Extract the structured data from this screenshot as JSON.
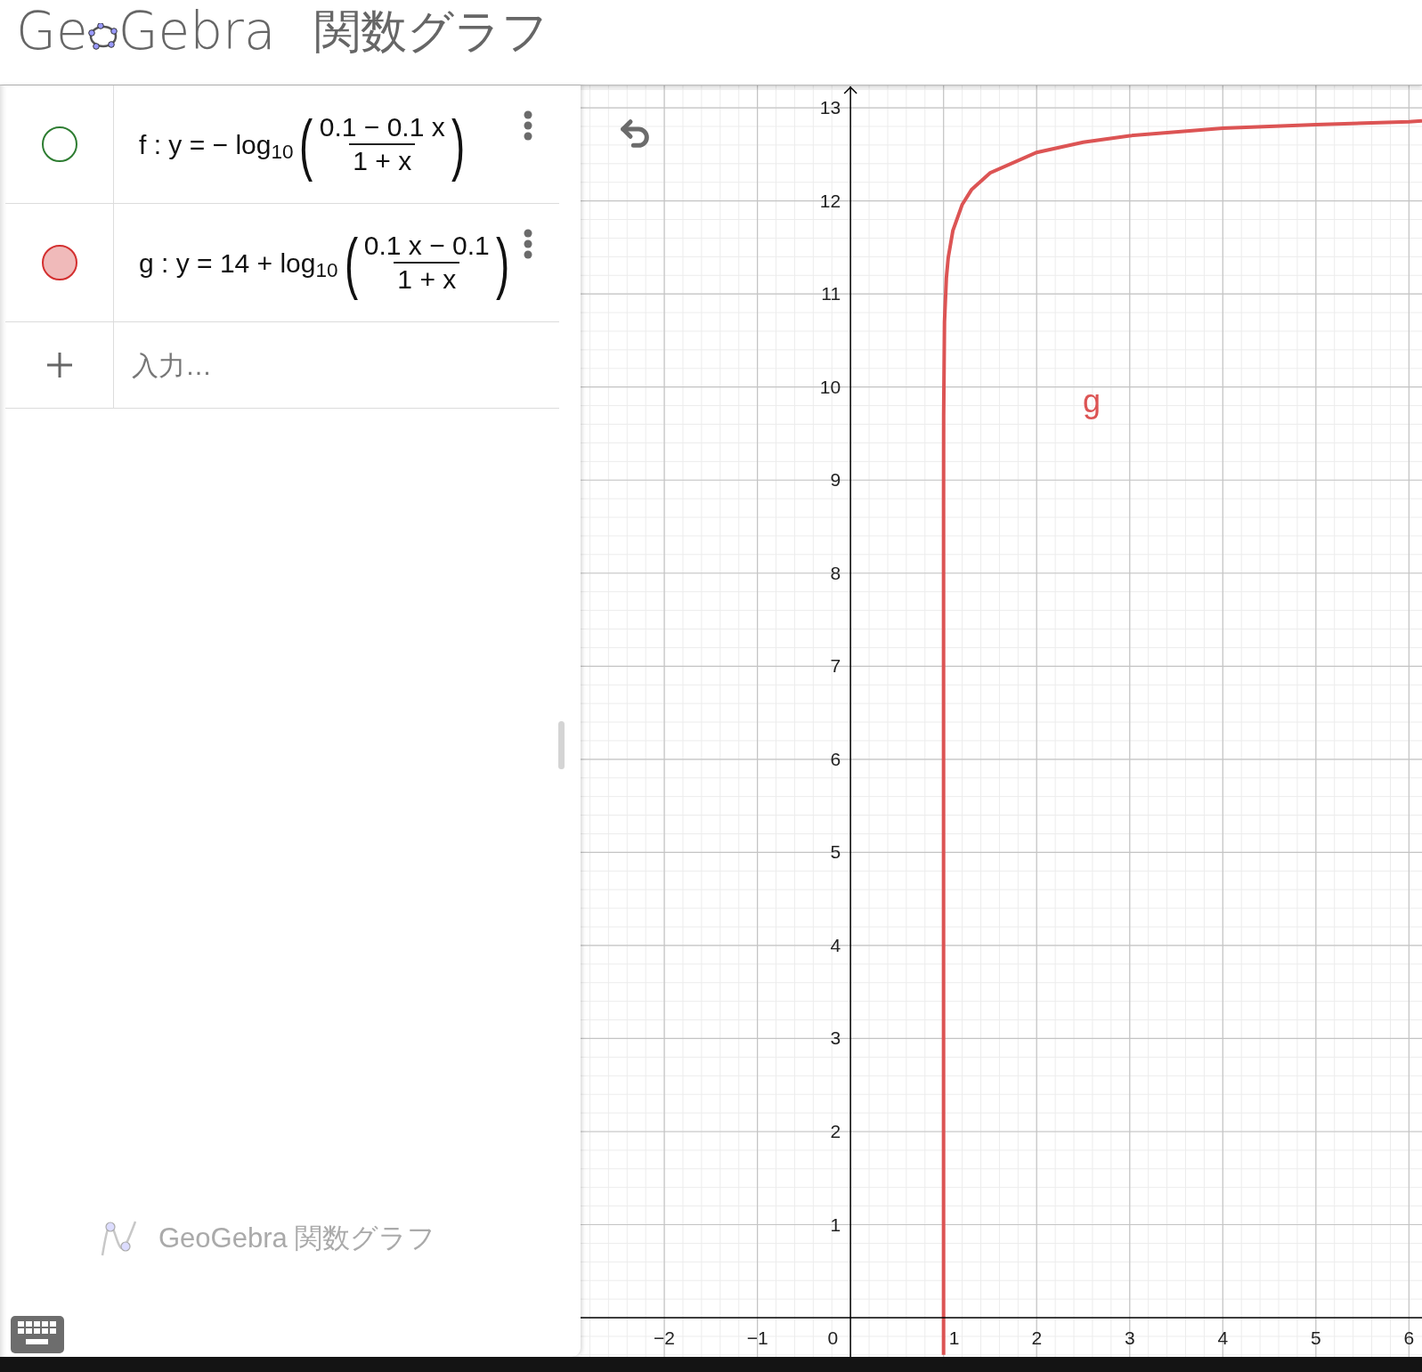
{
  "header": {
    "logo": {
      "before": "Ge",
      "after": "Gebra"
    },
    "title": "関数グラフ"
  },
  "algebra": {
    "rows": [
      {
        "prefix": "f : y = − log$_{10}$",
        "open": "(",
        "numerator": "0.1 − 0.1 x",
        "denominator": "1 + x",
        "close": ")",
        "color": "#2e7d32",
        "visible": false
      },
      {
        "prefix": "g : y = 14 + log$_{10}$",
        "open": "(",
        "numerator": "0.1 x − 0.1",
        "denominator": "1 + x",
        "close": ")",
        "color": "#d32f2f",
        "visible": true
      }
    ],
    "input": {
      "placeholder": "入力…"
    },
    "footer": "GeoGebra 関数グラフ"
  },
  "graph": {
    "origin_label": "0",
    "chart_data": {
      "type": "line",
      "xlim": [
        -2.9,
        6.14
      ],
      "ylim": [
        -0.42,
        13.24
      ],
      "grid": true,
      "xticks": [
        -2,
        -1,
        1,
        2,
        3,
        4,
        5,
        6
      ],
      "yticks": [
        1,
        2,
        3,
        4,
        5,
        6,
        7,
        8,
        9,
        10,
        11,
        12,
        13
      ],
      "x": [
        1.0000000000000795,
        1.0000000000001,
        1.000001,
        1.0001,
        1.001,
        1.01,
        1.03,
        1.05,
        1.1,
        1.2,
        1.3,
        1.5,
        2,
        2.5,
        3,
        4,
        5,
        6,
        6.14
      ],
      "series": [
        {
          "name": "g",
          "color": "#dc5454",
          "values": [
            -0.4,
            -0.3,
            6.7,
            8.7,
            9.7,
            10.7,
            11.17,
            11.39,
            11.68,
            11.96,
            12.12,
            12.3,
            12.52,
            12.63,
            12.7,
            12.78,
            12.82,
            12.85,
            12.86
          ]
        }
      ]
    }
  }
}
